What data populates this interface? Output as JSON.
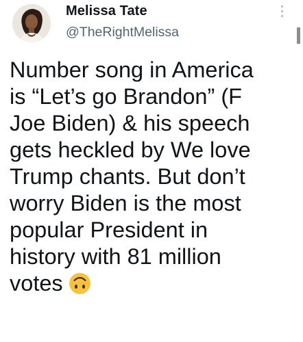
{
  "author": {
    "display_name": "Melissa Tate",
    "handle": "@TheRightMelissa",
    "avatar_icon": "profile-photo"
  },
  "tweet": {
    "text": "Number song in America\nis “Let’s go Brandon” (F\nJoe Biden) & his speech\ngets heckled by We love\nTrump chants. But don’t\nworry Biden is the most\npopular President in\nhistory with 81 million\nvotes",
    "emoji": "upside-down-face-icon"
  },
  "menu": {
    "icon": "more-options-icon"
  },
  "colors": {
    "text": "#0f1419",
    "secondary_text": "#536471",
    "emoji_face": "#f9c23c"
  }
}
